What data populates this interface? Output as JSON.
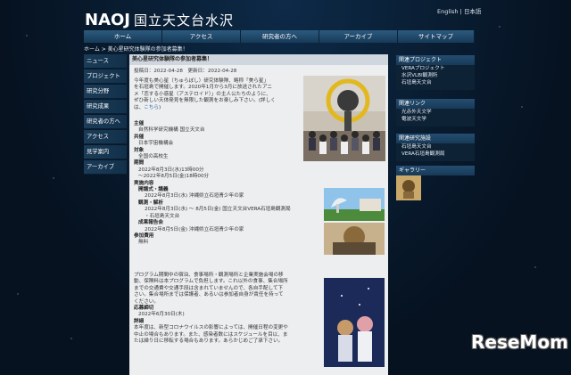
{
  "header": {
    "logo": "NAOJ",
    "name": "国立天文台水沢",
    "lang_en": "English",
    "lang_sep": "|",
    "lang_ja": "日本語"
  },
  "nav": [
    {
      "label": "ホーム"
    },
    {
      "label": "アクセス"
    },
    {
      "label": "研究者の方へ"
    },
    {
      "label": "アーカイブ"
    },
    {
      "label": "サイトマップ"
    }
  ],
  "breadcrumb": "ホーム > 美心星研究体験隊の参加者募集！",
  "sidebar": [
    {
      "label": "ニュース"
    },
    {
      "label": "プロジェクト"
    },
    {
      "label": "研究分野"
    },
    {
      "label": "研究成果"
    },
    {
      "label": "研究者の方へ"
    },
    {
      "label": "アクセス"
    },
    {
      "label": "見学案内"
    },
    {
      "label": "アーカイブ"
    }
  ],
  "article": {
    "heading": "美心星研究体験隊の参加者募集！",
    "date": "投稿日：2022-04-28　更新日：2022-04-28",
    "intro": [
      "今年度も美心星（ちゅらぼし）研究体験隊、略称「美ら星」",
      "を石垣島で開催します。2020年1月から3月に放送されたアニ",
      "メ「恋する小惑星（アステロイド）」の主人公たちのように、",
      "ぜひ新しい天体発見を無限した観測をお楽しみ下さい。(詳しく",
      "は、"
    ],
    "link_text": "こちら",
    "link_tail": ")",
    "sections": [
      {
        "label": "主催",
        "lines": [
          "自然科学研究機構 国立天文台"
        ]
      },
      {
        "label": "共催",
        "lines": [
          "日本宇宙機構会"
        ]
      },
      {
        "label": "対象",
        "lines": [
          "全国の高校生"
        ]
      },
      {
        "label": "期間",
        "lines": [
          "2022年8月3日(水)13時00分",
          "〜2022年8月5日(金)18時00分"
        ]
      },
      {
        "label": "実施内容",
        "lines": []
      }
    ],
    "program": [
      {
        "label": "開講式・講義",
        "lines": [
          "2022年8月3日(水) 沖縄県立石垣青少年の家"
        ]
      },
      {
        "label": "観測・解析",
        "lines": [
          "2022年8月3日(水) 〜 8月5日(金) 国立天文台VERA石垣島観測局",
          "・石垣島天文台"
        ]
      },
      {
        "label": "成果報告会",
        "lines": [
          "2022年8月5日(金) 沖縄県立石垣青少年の家"
        ]
      }
    ],
    "fee_label": "参加費用",
    "fee": "無料",
    "notes": [
      "プログラム期間中の宿泊、食事場所・観測場所と企業実施会場の移",
      "動、保険料は本プログラムで負担します。これ以外の食事、集合場所",
      "までの交通費や交通手段は含まれていませんので、各自手配して下",
      "さい。集合場所までは保護者、あるいは参加者自身が責任を持って",
      "ください。"
    ],
    "deadline_label": "応募締切",
    "deadline": "2022年6月30日(木)",
    "detail_label": "詳細",
    "detail": [
      "本年度は、新型コロナウイルスの影響によっては、開催日程の変更や",
      "中止の場合もあります。また、感染者数にはスケジュールを目以、ま",
      "たは繰り日に移転する場合もあります。あらかじめご了承下さい。"
    ]
  },
  "right": {
    "related_head": "関連プロジェクト",
    "related": [
      "VERAプロジェクト",
      "水沢VLBI観測所",
      "石垣島天文台"
    ],
    "links_head": "関連リンク",
    "links": [
      "光赤外天文学",
      "電波天文学"
    ],
    "bases_head": "関連研究施設",
    "bases": [
      "石垣島天文台",
      "VERA石垣島観測局"
    ],
    "gallery_head": "ギャラリー"
  },
  "watermark": "ReseMom"
}
